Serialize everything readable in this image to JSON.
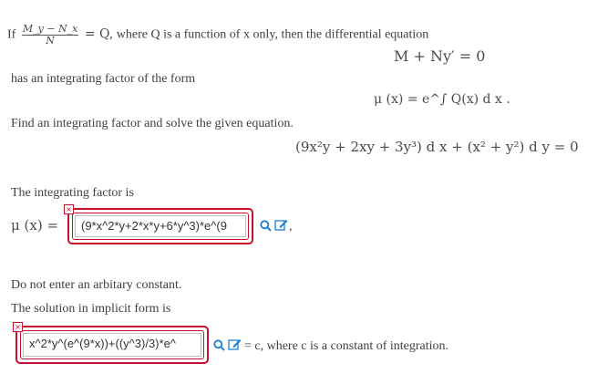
{
  "intro": {
    "if_word": "If",
    "frac_num": "M_y − N_x",
    "frac_den": "N",
    "eq_q": "= Q,",
    "rest": "where Q is a function of x only, then the differential equation",
    "equation": "M + Ny′ = 0",
    "line2": "has an integrating factor of the form",
    "formula": "μ (x) = e^∫ Q(x) d x ."
  },
  "task": {
    "text": "Find an integrating factor and solve the given equation.",
    "equation": "(9x²y + 2xy + 3y³) d x + (x² + y²) d y = 0"
  },
  "part1": {
    "label": "The integrating factor is",
    "mu_lhs": "μ (x) =",
    "answer": "(9*x^2*y+2*x*y+6*y^3)*e^(9",
    "after": ","
  },
  "part2": {
    "note": "Do not enter an arbitary constant.",
    "label": "The solution in implicit form is",
    "answer": "x^2*y^(e^(9*x))+((y^3)/3)*e^",
    "after": "= c, where c is a constant of integration."
  },
  "colors": {
    "error": "#c8102e",
    "icon": "#1a7fd4",
    "text": "#3f3f3f"
  },
  "icons": [
    "search-icon",
    "edit-icon",
    "error-x-icon"
  ]
}
